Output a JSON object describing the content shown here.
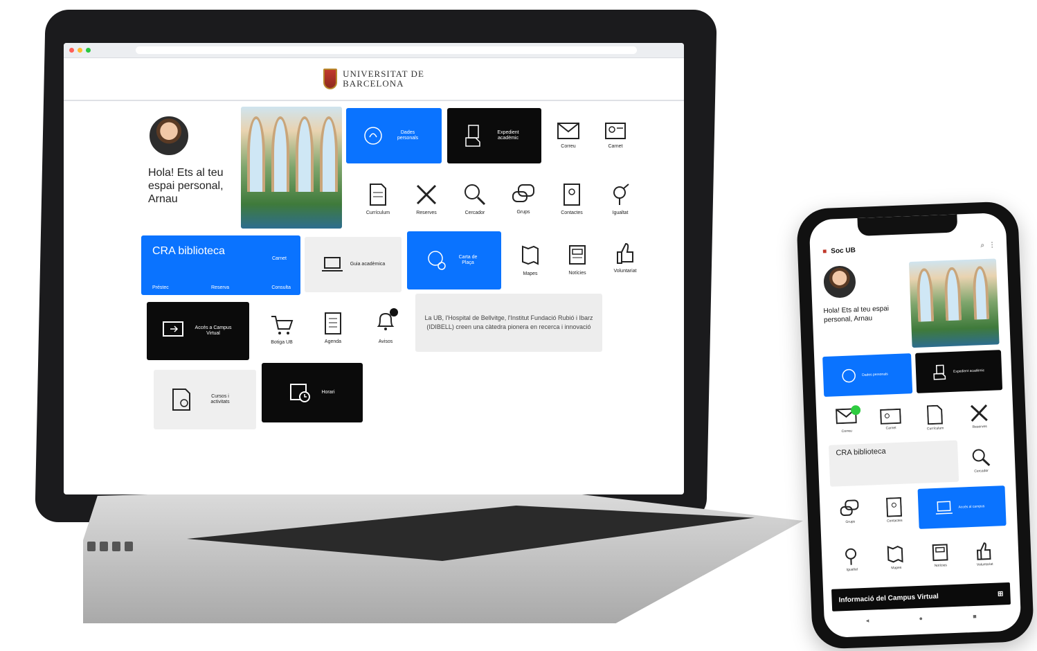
{
  "university": {
    "line1": "UNIVERSITAT DE",
    "line2": "BARCELONA"
  },
  "laptop": {
    "greeting": "Hola! Ets al teu espai personal, Arnau",
    "tiles": {
      "dades_personals": "Dades personals",
      "expedient": "Expedient acadèmic",
      "correu": "Correu",
      "carnet": "Carnet",
      "curriculum": "Currículum",
      "reserves": "Reserves",
      "cercador": "Cercador",
      "grups": "Grups",
      "contactes": "Contactes",
      "igualtat": "Igualtat",
      "cra_title": "CRA biblioteca",
      "cra_sub": [
        "Préstec",
        "Reserva",
        "Consulta"
      ],
      "cra_top": "Carnet",
      "guia": "Guia acadèmica",
      "carta": "Carta de Plaça",
      "mapes": "Mapes",
      "noticies": "Notícies",
      "voluntariat": "Voluntariat",
      "campus": "Accés a Campus Virtual",
      "botiga": "Botiga UB",
      "agenda": "Agenda",
      "avisos": "Avisos",
      "cursos": "Cursos i activitats",
      "horari": "Horari"
    },
    "notice": "La UB, l'Hospital de Bellvitge, l'Institut Fundació Rubió i Ibarz (IDIBELL) creen una càtedra pionera en recerca i innovació"
  },
  "phone": {
    "app_title": "Soc UB",
    "greeting": "Hola! Ets al teu espai personal, Arnau",
    "tiles": {
      "dades": "Dades personals",
      "expedient": "Expedient acadèmic",
      "correu": "Correu",
      "carnet": "Carnet",
      "curriculum": "Currículum",
      "reserves": "Reserves",
      "cra_title": "CRA biblioteca",
      "cercador": "Cercador",
      "grups": "Grups",
      "contactes": "Contactes",
      "campus": "Accés al campus",
      "igualtat": "Igualtat",
      "mapes": "Mapes",
      "noticies": "Notícies",
      "voluntariat": "Voluntariat"
    },
    "bottom_banner": "Informació del Campus Virtual",
    "nav": [
      "◂",
      "●",
      "■"
    ]
  },
  "colors": {
    "blue": "#0a73ff",
    "black": "#0b0b0b",
    "grey": "#efefef",
    "green_badge": "#2ecc40"
  }
}
